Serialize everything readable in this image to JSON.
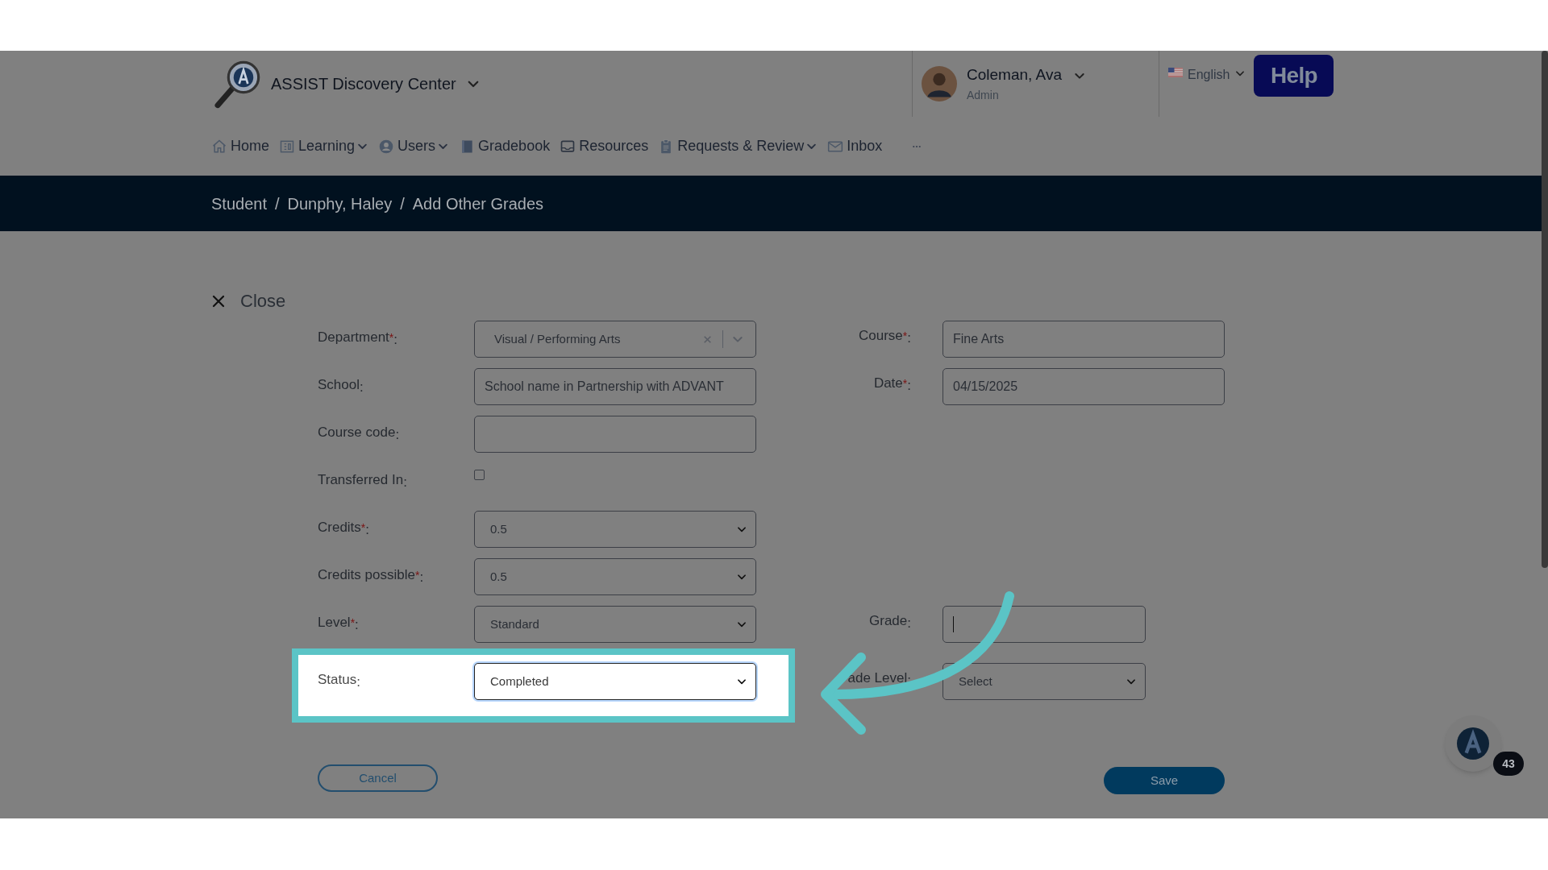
{
  "header": {
    "app_title": "ASSIST Discovery Center",
    "user": {
      "name": "Coleman, Ava",
      "role": "Admin"
    },
    "language": "English",
    "help": "Help"
  },
  "nav": [
    {
      "label": "Home",
      "kind": "home",
      "dropdown": false
    },
    {
      "label": "Learning",
      "kind": "grid",
      "dropdown": true
    },
    {
      "label": "Users",
      "kind": "user",
      "dropdown": true
    },
    {
      "label": "Gradebook",
      "kind": "book",
      "dropdown": false
    },
    {
      "label": "Resources",
      "kind": "tray",
      "dropdown": false
    },
    {
      "label": "Requests & Review",
      "kind": "clipboard",
      "dropdown": true
    },
    {
      "label": "Inbox",
      "kind": "mail",
      "dropdown": false
    },
    {
      "kind": "more"
    }
  ],
  "breadcrumb": {
    "items": [
      "Student",
      "Dunphy, Haley",
      "Add Other Grades"
    ],
    "separator": "/"
  },
  "close": "Close",
  "rows": [
    {
      "highlighted": false,
      "left": {
        "label": "Department",
        "required_mark": "*",
        "colon": ":",
        "kind": "combobox",
        "value": "Visual / Performing Arts"
      },
      "right": {
        "label": "Course",
        "required_mark": "*",
        "colon": ":",
        "kind": "text",
        "value": "Fine Arts",
        "wide": true
      }
    },
    {
      "highlighted": false,
      "left": {
        "label": "School",
        "colon": ":",
        "kind": "text",
        "value": "School name in Partnership with ADVANT"
      },
      "right": {
        "label": "Date",
        "required_mark": "*",
        "colon": ":",
        "kind": "text",
        "value": "04/15/2025",
        "wide": true
      }
    },
    {
      "highlighted": false,
      "left": {
        "label": "Course code",
        "colon": ":",
        "kind": "text"
      }
    },
    {
      "highlighted": false,
      "left": {
        "label": "Transferred In",
        "colon": ":",
        "kind": "checkbox",
        "checked": false
      }
    },
    {
      "highlighted": false,
      "left": {
        "label": "Credits",
        "required_mark": "*",
        "colon": ":",
        "kind": "select",
        "value": "0.5"
      }
    },
    {
      "highlighted": false,
      "left": {
        "label": "Credits possible",
        "required_mark": "*",
        "colon": ":",
        "kind": "select",
        "value": "0.5"
      }
    },
    {
      "highlighted": false,
      "left": {
        "label": "Level",
        "required_mark": "*",
        "colon": ":",
        "kind": "select",
        "value": "Standard"
      },
      "right": {
        "label": "Grade",
        "colon": ":",
        "kind": "text",
        "focused": true,
        "wide": false
      }
    },
    {
      "highlighted": true,
      "left": {
        "label": "Status",
        "colon": ":",
        "kind": "select",
        "value": "Completed"
      },
      "right": {
        "label": "ade Level",
        "colon": ":",
        "kind": "select",
        "value": "Select",
        "wide": false
      }
    }
  ],
  "buttons": {
    "cancel": "Cancel",
    "save": "Save"
  },
  "notifications": {
    "count": "43"
  }
}
